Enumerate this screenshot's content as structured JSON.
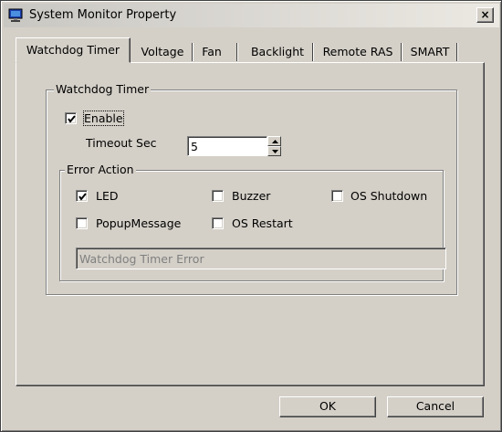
{
  "window": {
    "title": "System Monitor Property",
    "close_label": "×"
  },
  "tabs": [
    {
      "label": "Watchdog Timer",
      "active": true
    },
    {
      "label": "Voltage",
      "active": false
    },
    {
      "label": "Fan",
      "active": false
    },
    {
      "label": "Backlight",
      "active": false
    },
    {
      "label": "Remote RAS",
      "active": false
    },
    {
      "label": "SMART",
      "active": false
    }
  ],
  "watchdog": {
    "group_label": "Watchdog Timer",
    "enable_label": "Enable",
    "enable_checked": true,
    "timeout_label": "Timeout Sec",
    "timeout_value": "5"
  },
  "error_action": {
    "group_label": "Error Action",
    "led_label": "LED",
    "led_checked": true,
    "buzzer_label": "Buzzer",
    "buzzer_checked": false,
    "os_shutdown_label": "OS Shutdown",
    "os_shutdown_checked": false,
    "popup_label": "PopupMessage",
    "popup_checked": false,
    "os_restart_label": "OS Restart",
    "os_restart_checked": false,
    "message_value": "Watchdog Timer Error"
  },
  "buttons": {
    "ok_label": "OK",
    "cancel_label": "Cancel"
  },
  "colors": {
    "face": "#d4d0c8",
    "shadow": "#808080",
    "dark_shadow": "#404040",
    "highlight": "#ffffff",
    "icon_blue": "#1c3fae"
  }
}
